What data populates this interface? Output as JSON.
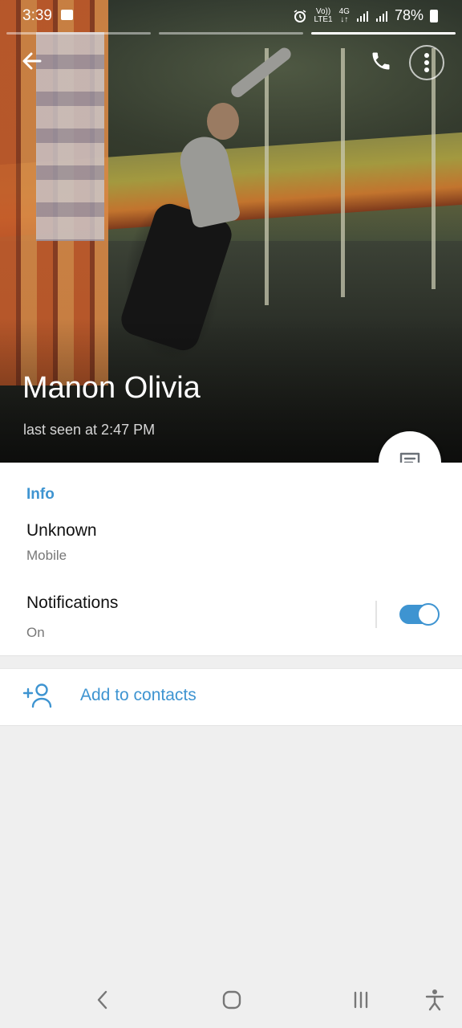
{
  "status_bar": {
    "time": "3:39",
    "network_top": "Vo))",
    "network_bottom": "LTE1",
    "data_top": "4G",
    "data_bottom": "↓↑",
    "battery": "78%"
  },
  "header": {
    "name": "Manon Olivia",
    "last_seen": "last seen at 2:47 PM"
  },
  "info": {
    "section_title": "Info",
    "phone_value": "Unknown",
    "phone_type": "Mobile",
    "notifications_label": "Notifications",
    "notifications_state": "On",
    "notifications_enabled": true
  },
  "actions": {
    "add_to_contacts": "Add to contacts"
  },
  "colors": {
    "accent": "#3e94d1",
    "background": "#efefef"
  },
  "icons": {
    "back": "arrow-left-icon",
    "call": "phone-icon",
    "menu": "more-vertical-icon",
    "message": "chat-icon",
    "add_contact": "person-add-icon"
  }
}
